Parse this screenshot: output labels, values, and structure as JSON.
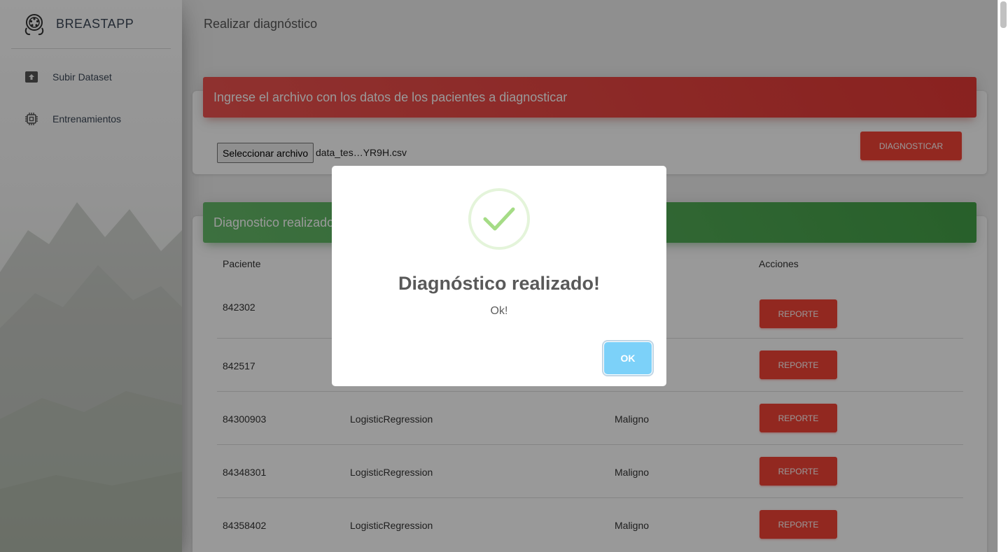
{
  "brand": {
    "name": "BREASTAPP",
    "logo_icon": "ribbon-film-logo"
  },
  "sidebar": {
    "items": [
      {
        "label": "Subir Dataset",
        "icon": "archive-upload-icon"
      },
      {
        "label": "Entrenamientos",
        "icon": "cpu-chip-icon"
      }
    ]
  },
  "page": {
    "title": "Realizar diagnóstico"
  },
  "upload_card": {
    "header": "Ingrese el archivo con los datos de los pacientes a diagnosticar",
    "file_button": "Seleccionar archivo",
    "file_name": "data_tes…YR9H.csv",
    "submit": "DIAGNOSTICAR"
  },
  "results_card": {
    "header": "Diagnostico realizado",
    "columns": [
      "Paciente",
      "Acciones"
    ],
    "rows": [
      {
        "patient": "842302",
        "model": "",
        "result": "",
        "action": "REPORTE"
      },
      {
        "patient": "842517",
        "model": "",
        "result": "",
        "action": "REPORTE"
      },
      {
        "patient": "84300903",
        "model": "LogisticRegression",
        "result": "Maligno",
        "action": "REPORTE"
      },
      {
        "patient": "84348301",
        "model": "LogisticRegression",
        "result": "Maligno",
        "action": "REPORTE"
      },
      {
        "patient": "84358402",
        "model": "LogisticRegression",
        "result": "Maligno",
        "action": "REPORTE"
      }
    ]
  },
  "modal": {
    "title": "Diagnóstico realizado!",
    "text": "Ok!",
    "confirm": "OK",
    "icon": "success-check-icon"
  },
  "colors": {
    "danger": "#f44336",
    "success": "#43a047",
    "confirm": "#7cd1f9"
  }
}
